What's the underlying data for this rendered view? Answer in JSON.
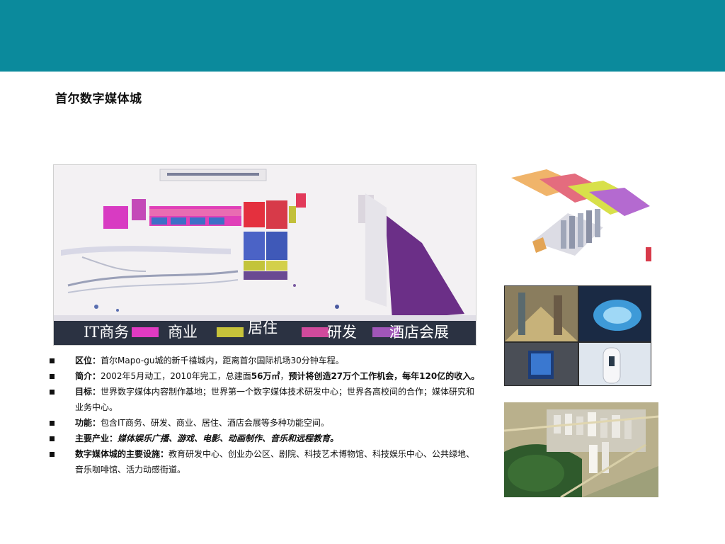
{
  "title": "首尔数字媒体城",
  "legend": [
    {
      "label": "IT商务",
      "swatch": "#e13ac2"
    },
    {
      "label": "商业",
      "swatch": "#c7c33a"
    },
    {
      "label": "居住",
      "swatch": "#d04a9c"
    },
    {
      "label": "研发",
      "swatch": "#a056b8"
    },
    {
      "label": "酒店会展",
      "swatch": "#6f3a8a"
    }
  ],
  "bullets": [
    {
      "key": "区位：",
      "text": "首尔Mapo-gu城的新千禧城内，距离首尔国际机场30分钟车程。"
    },
    {
      "key": "简介：",
      "text_a": "2002年5月动工，2010年完工，总建面",
      "bold_a": "56万㎡",
      "text_b": "，",
      "bold_b": "预计将创造27万个工作机会，每年120亿的收入。"
    },
    {
      "key": "目标：",
      "text": "世界数字媒体内容制作基地；世界第一个数字媒体技术研发中心；世界各高校间的合作；媒体研究和业务中心。"
    },
    {
      "key": "功能：",
      "text": "包含IT商务、研发、商业、居住、酒店会展等多种功能空间。"
    },
    {
      "key": "主要产业：",
      "text": "媒体娱乐广播、游戏、电影、动画制作、音乐和远程教育。"
    },
    {
      "key": "数字媒体城的主要设施：",
      "text": "教育研发中心、创业办公区、剧院、科技艺术博物馆、科技娱乐中心、公共绿地、音乐咖啡馆、活力动感街道。"
    }
  ],
  "colors": {
    "header": "#0b8a9c",
    "legend_bar": "#2b3242"
  }
}
